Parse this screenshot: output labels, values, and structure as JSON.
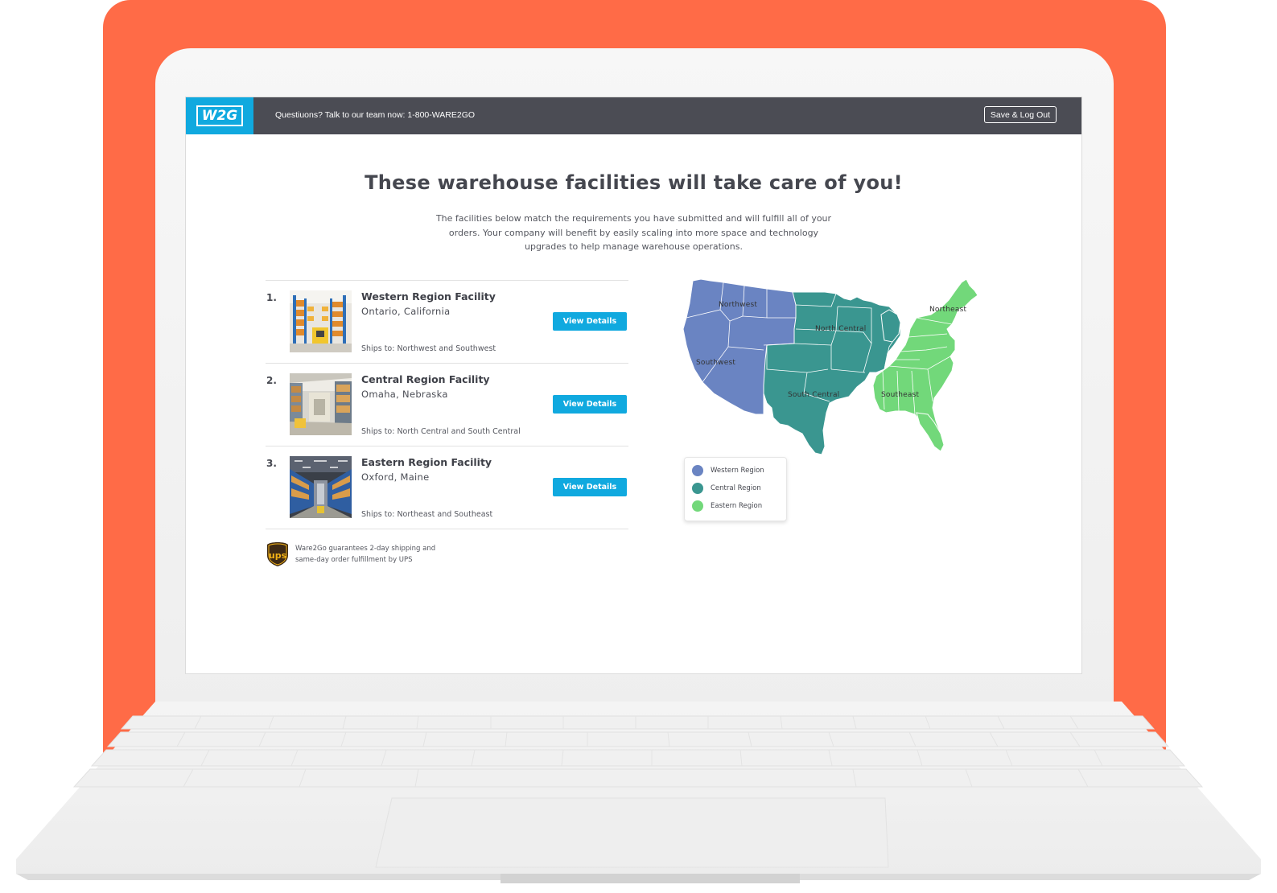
{
  "header": {
    "logo": "W2G",
    "help_text": "Questiuons? Talk to our team now: 1-800-WARE2GO",
    "logout_label": "Save & Log Out"
  },
  "main": {
    "headline": "These warehouse facilities will take care of you!",
    "intro": "The facilities below match the requirements you have submitted and will fulfill all of your orders. Your company will benefit by easily scaling into more space and technology upgrades to help manage warehouse operations."
  },
  "facilities": [
    {
      "number": "1.",
      "name": "Western Region Facility",
      "location": "Ontario, California",
      "ships_to": "Ships to: Northwest and Southwest",
      "button": "View Details"
    },
    {
      "number": "2.",
      "name": "Central Region Facility",
      "location": "Omaha, Nebraska",
      "ships_to": "Ships to: North Central and South Central",
      "button": "View Details"
    },
    {
      "number": "3.",
      "name": "Eastern Region Facility",
      "location": "Oxford, Maine",
      "ships_to": "Ships to: Northeast and Southeast",
      "button": "View Details"
    }
  ],
  "ups": {
    "logo": "ups",
    "line1": "Ware2Go guarantees 2-day shipping and",
    "line2": "same-day order fulfillment by UPS"
  },
  "map": {
    "region_labels": [
      "Northwest",
      "North Central",
      "Northeast",
      "Southwest",
      "South Central",
      "Southeast"
    ],
    "legend": [
      {
        "label": "Western Region",
        "color": "#6a84c2"
      },
      {
        "label": "Central Region",
        "color": "#3a9690"
      },
      {
        "label": "Eastern Region",
        "color": "#72d87a"
      }
    ]
  },
  "colors": {
    "accent": "#10a9df",
    "topbar": "#4b4c54",
    "laptop_lid": "#ff6b47"
  }
}
